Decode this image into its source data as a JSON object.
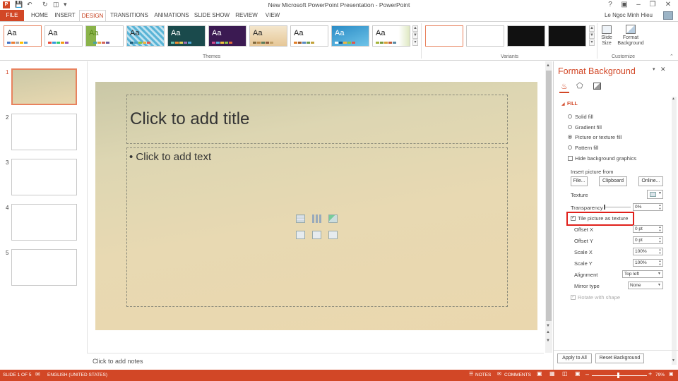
{
  "window": {
    "title": "New Microsoft PowerPoint Presentation - PowerPoint",
    "user": "Le Ngoc Minh Hieu"
  },
  "tabs": [
    "FILE",
    "HOME",
    "INSERT",
    "DESIGN",
    "TRANSITIONS",
    "ANIMATIONS",
    "SLIDE SHOW",
    "REVIEW",
    "VIEW"
  ],
  "ribbon": {
    "themes_label": "Themes",
    "variants_label": "Variants",
    "customize_label": "Customize",
    "theme_sample": "Aa",
    "slide_size": "Slide\nSize",
    "format_background": "Format\nBackground"
  },
  "slides": {
    "numbers": [
      "1",
      "2",
      "3",
      "4",
      "5"
    ]
  },
  "slide": {
    "title_placeholder": "Click to add title",
    "text_placeholder": "• Click to add text"
  },
  "notes": {
    "placeholder": "Click to add notes"
  },
  "pane": {
    "title": "Format Background",
    "fill_header": "FILL",
    "solid": "Solid fill",
    "gradient": "Gradient fill",
    "picture": "Picture or texture fill",
    "pattern": "Pattern fill",
    "hide": "Hide background graphics",
    "insert_from": "Insert picture from",
    "file_btn": "File...",
    "clipboard_btn": "Clipboard",
    "online_btn": "Online...",
    "texture": "Texture",
    "transparency": "Transparency",
    "transparency_value": "0%",
    "tile": "Tile picture as texture",
    "offset_x": "Offset X",
    "offset_x_value": "0 pt",
    "offset_y": "Offset Y",
    "offset_y_value": "0 pt",
    "scale_x": "Scale X",
    "scale_x_value": "100%",
    "scale_y": "Scale Y",
    "scale_y_value": "100%",
    "alignment": "Alignment",
    "alignment_value": "Top left",
    "mirror": "Mirror type",
    "mirror_value": "None",
    "rotate": "Rotate with shape",
    "apply_all": "Apply to All",
    "reset": "Reset Background"
  },
  "status": {
    "slide": "SLIDE 1 OF 5",
    "language": "ENGLISH (UNITED STATES)",
    "notes": "NOTES",
    "comments": "COMMENTS",
    "zoom": "79%"
  },
  "colors": {
    "accent": "#d24726",
    "highlight_box": "#e0201b"
  }
}
